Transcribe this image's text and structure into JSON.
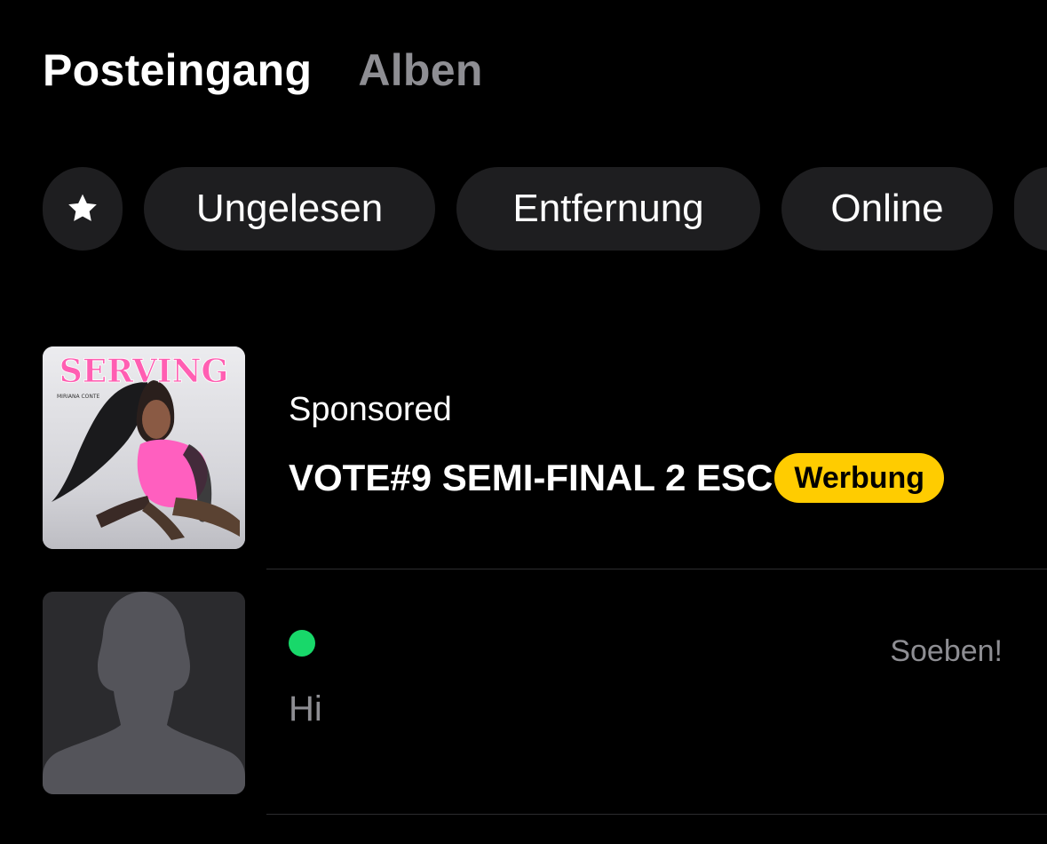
{
  "tabs": [
    {
      "label": "Posteingang",
      "active": true
    },
    {
      "label": "Alben",
      "active": false
    }
  ],
  "filters": {
    "star_icon": "star-icon",
    "chips": [
      "Ungelesen",
      "Entfernung",
      "Online"
    ]
  },
  "conversations": [
    {
      "type": "sponsored",
      "thumbnail": {
        "title": "SERVING",
        "artist": "MIRIANA CONTE"
      },
      "label": "Sponsored",
      "title": "VOTE#9 SEMI-FINAL 2 ESC",
      "badge": "Werbung"
    },
    {
      "type": "chat",
      "avatar_icon": "default-avatar-icon",
      "online": true,
      "timestamp": "Soeben!",
      "preview": "Hi"
    }
  ],
  "colors": {
    "background": "#000000",
    "chip_background": "#1e1e20",
    "badge": "#ffcc00",
    "online": "#18d86a",
    "muted_text": "#8e8e93"
  }
}
